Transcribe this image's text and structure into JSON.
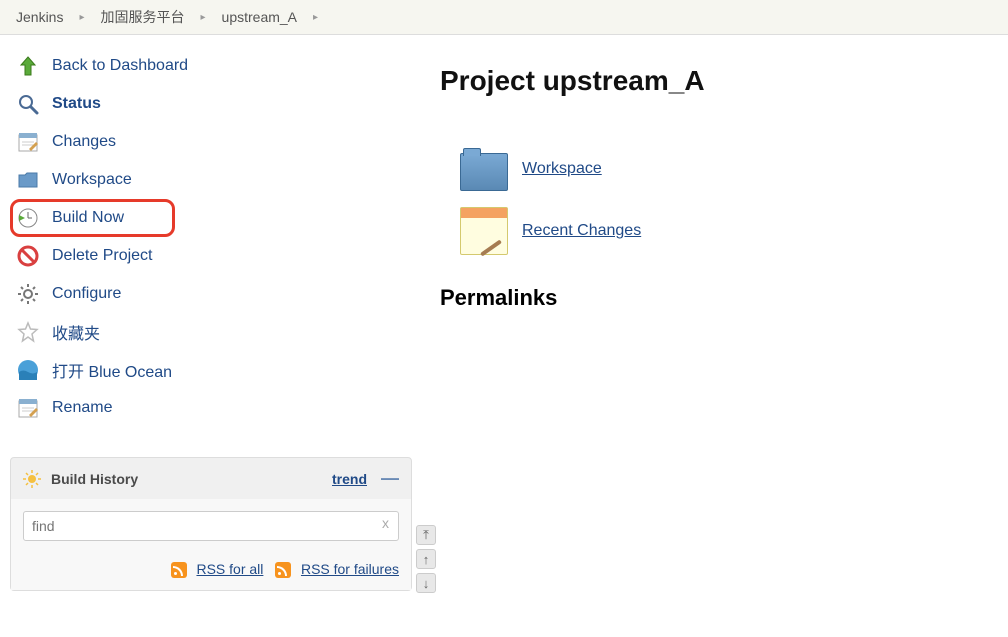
{
  "breadcrumb": [
    {
      "label": "Jenkins"
    },
    {
      "label": "加固服务平台"
    },
    {
      "label": "upstream_A"
    }
  ],
  "sidebar": {
    "items": [
      {
        "label": "Back to Dashboard"
      },
      {
        "label": "Status",
        "active": true
      },
      {
        "label": "Changes"
      },
      {
        "label": "Workspace"
      },
      {
        "label": "Build Now",
        "highlighted": true
      },
      {
        "label": "Delete Project"
      },
      {
        "label": "Configure"
      },
      {
        "label": "收藏夹"
      },
      {
        "label": "打开 Blue Ocean"
      },
      {
        "label": "Rename"
      }
    ]
  },
  "build_history": {
    "title": "Build History",
    "trend_label": "trend",
    "find_placeholder": "find",
    "clear_label": "x",
    "rss_all": "RSS for all",
    "rss_failures": "RSS for failures"
  },
  "main": {
    "title": "Project upstream_A",
    "workspace_link": "Workspace",
    "recent_changes_link": "Recent Changes",
    "permalinks_heading": "Permalinks"
  }
}
